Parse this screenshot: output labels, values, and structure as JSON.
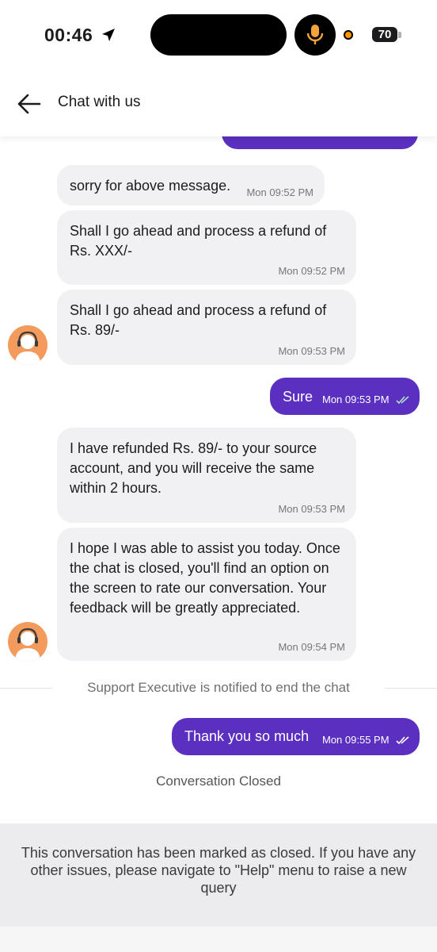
{
  "status_bar": {
    "time": "00:46",
    "battery": "70",
    "icons": [
      "location-arrow-icon",
      "microphone-icon",
      "orange-privacy-dot",
      "battery-icon"
    ]
  },
  "header": {
    "title": "Chat with us",
    "back_icon": "back-arrow-icon"
  },
  "messages": [
    {
      "side": "incoming",
      "text": "sorry for above message.",
      "time": "Mon 09:52 PM"
    },
    {
      "side": "incoming",
      "text": "Shall I go ahead and process a refund of Rs. XXX/-",
      "time": "Mon 09:52 PM"
    },
    {
      "side": "incoming",
      "text": "Shall I go ahead and process a refund of Rs. 89/-",
      "time": "Mon 09:53 PM"
    },
    {
      "side": "outgoing",
      "text": "Sure",
      "time": "Mon 09:53 PM"
    },
    {
      "side": "incoming",
      "text": "I have refunded Rs. 89/- to your source account, and you will receive the same within 2 hours.",
      "time": "Mon 09:53 PM"
    },
    {
      "side": "incoming",
      "text": "I hope I was able to assist you today. Once the chat is closed, you'll find an option on the screen to rate our conversation. Your feedback will be greatly appreciated.",
      "time": "Mon 09:54 PM"
    },
    {
      "side": "outgoing",
      "text": "Thank you so much",
      "time": "Mon 09:55 PM"
    }
  ],
  "system": {
    "notified": "Support Executive is notified to end the chat",
    "closed": "Conversation Closed"
  },
  "notice": "This conversation has been marked as closed. If you have any other issues, please navigate to \"Help\" menu to raise a new query",
  "colors": {
    "outgoing_bubble": "#5b2fc0",
    "incoming_bubble": "#f1f1f4",
    "avatar": "#f39a5d",
    "notice_bg": "#ececef"
  }
}
